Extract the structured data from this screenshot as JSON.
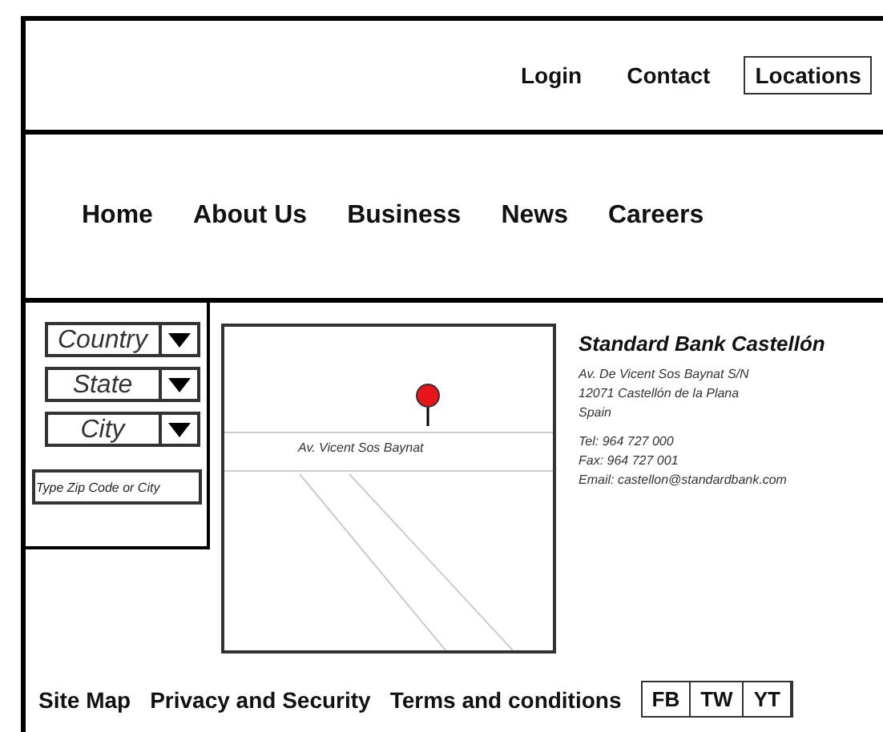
{
  "top_links": [
    {
      "label": "Login",
      "selected": false
    },
    {
      "label": "Contact",
      "selected": false
    },
    {
      "label": "Locations",
      "selected": true
    }
  ],
  "nav": [
    "Home",
    "About Us",
    "Business",
    "News",
    "Careers"
  ],
  "filters": {
    "dropdowns": [
      "Country",
      "State",
      "City"
    ],
    "zip_field": {
      "placeholder": "Type Zip Code or City"
    }
  },
  "map": {
    "street_label": "Av. Vicent Sos Baynat"
  },
  "branch": {
    "name": "Standard Bank  Castellón",
    "address": [
      "Av. De Vicent Sos Baynat S/N",
      "12071 Castellón de la Plana",
      "Spain"
    ],
    "contact": [
      "Tel: 964 727 000",
      "Fax: 964 727 001",
      "Email: castellon@standardbank.com"
    ]
  },
  "footer_links": [
    "Site Map",
    "Privacy and Security",
    "Terms and conditions"
  ],
  "social_buttons": [
    "FB",
    "TW",
    "YT"
  ]
}
